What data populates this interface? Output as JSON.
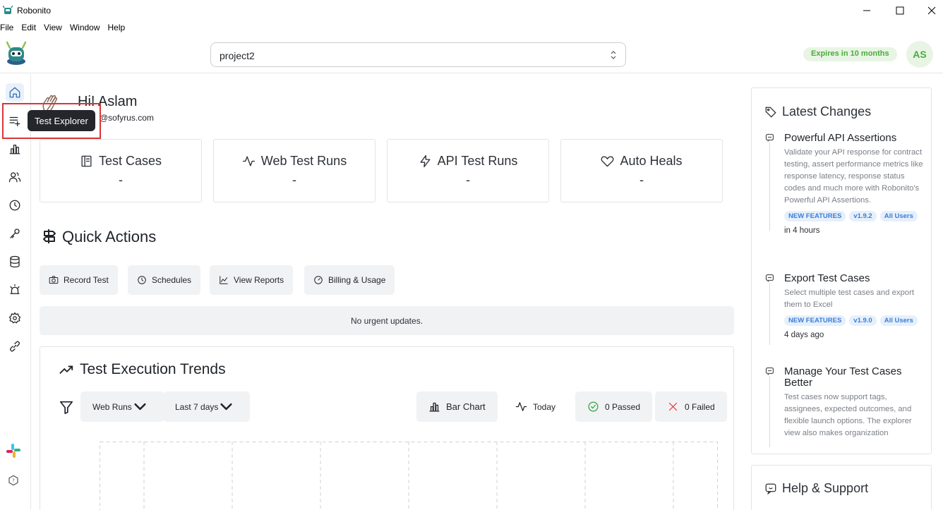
{
  "window": {
    "title": "Robonito",
    "controls": [
      "minimize-icon",
      "maximize-icon",
      "close-icon"
    ]
  },
  "menu": [
    "File",
    "Edit",
    "View",
    "Window",
    "Help"
  ],
  "header": {
    "project": "project2",
    "expires": "Expires in 10 months",
    "avatar_initials": "AS"
  },
  "sidebar": {
    "items": [
      {
        "name": "home",
        "icon": "home-icon",
        "active": true
      },
      {
        "name": "test-explorer",
        "icon": "list-add-icon"
      },
      {
        "name": "reports",
        "icon": "bar-chart-icon"
      },
      {
        "name": "users",
        "icon": "users-icon"
      },
      {
        "name": "history",
        "icon": "clock-icon"
      },
      {
        "name": "keys",
        "icon": "key-icon"
      },
      {
        "name": "database",
        "icon": "database-icon"
      },
      {
        "name": "alerts",
        "icon": "alarm-icon"
      },
      {
        "name": "settings",
        "icon": "gear-icon"
      },
      {
        "name": "integrations",
        "icon": "link-icon"
      }
    ],
    "tooltip": "Test Explorer"
  },
  "greeting": {
    "title": "Hi! Aslam",
    "email": "@sofyrus.com"
  },
  "stats": [
    {
      "label": "Test Cases",
      "value": "-",
      "icon": "document-icon"
    },
    {
      "label": "Web Test Runs",
      "value": "-",
      "icon": "activity-icon"
    },
    {
      "label": "API Test Runs",
      "value": "-",
      "icon": "bolt-icon"
    },
    {
      "label": "Auto Heals",
      "value": "-",
      "icon": "heart-icon"
    }
  ],
  "quick_actions": {
    "title": "Quick Actions",
    "buttons": [
      {
        "label": "Record Test",
        "icon": "camera-icon"
      },
      {
        "label": "Schedules",
        "icon": "clock-icon"
      },
      {
        "label": "View Reports",
        "icon": "chart-line-icon"
      },
      {
        "label": "Billing & Usage",
        "icon": "gauge-icon"
      }
    ],
    "urgent": "No urgent updates."
  },
  "trends": {
    "title": "Test Execution Trends",
    "run_type": "Web Runs",
    "range": "Last 7 days",
    "chart_type": "Bar Chart",
    "today": "Today",
    "passed": "0 Passed",
    "failed": "0 Failed",
    "colors": {
      "passed": "#2eaa3c",
      "failed": "#e04343"
    }
  },
  "latest_changes": {
    "title": "Latest Changes",
    "items": [
      {
        "title": "Powerful API Assertions",
        "description": "Validate your API response for contract testing, assert performance metrics like response latency, response status codes and much more with Robonito's Powerful API Assertions.",
        "badges": [
          "NEW FEATURES",
          "v1.9.2",
          "All Users"
        ],
        "time": "in 4 hours"
      },
      {
        "title": "Export Test Cases",
        "description": "Select multiple test cases and export them to Excel",
        "badges": [
          "NEW FEATURES",
          "v1.9.0",
          "All Users"
        ],
        "time": "4 days ago"
      },
      {
        "title": "Manage Your Test Cases Better",
        "description": "Test cases now support tags, assignees, expected outcomes, and flexible launch options. The explorer view also makes organization",
        "badges": [],
        "time": ""
      }
    ]
  },
  "help": {
    "title": "Help & Support"
  }
}
